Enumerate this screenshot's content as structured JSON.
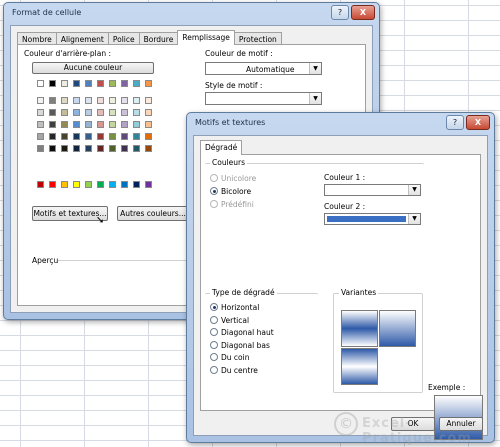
{
  "back_dialog": {
    "title": "Format de cellule",
    "tabs": [
      "Nombre",
      "Alignement",
      "Police",
      "Bordure",
      "Remplissage",
      "Protection"
    ],
    "active_tab": "Remplissage",
    "bg_color_label": "Couleur d'arrière-plan :",
    "no_color_button": "Aucune couleur",
    "pattern_color_label": "Couleur de motif :",
    "pattern_color_value": "Automatique",
    "pattern_style_label": "Style de motif :",
    "pattern_style_value": "",
    "patterns_button": "Motifs et textures...",
    "more_colors_button": "Autres couleurs...",
    "preview_label": "Aperçu",
    "help_label": "?",
    "close_label": "X"
  },
  "palette": {
    "row1": [
      "#ffffff",
      "#000000",
      "#eeece1",
      "#1f497d",
      "#4f81bd",
      "#c0504d",
      "#9bbb59",
      "#8064a2",
      "#4bacc6",
      "#f79646"
    ],
    "rows": [
      [
        "#f2f2f2",
        "#7f7f7f",
        "#ddd9c3",
        "#c6d9f0",
        "#dbe5f1",
        "#f2dcdb",
        "#ebf1dd",
        "#e5e0ec",
        "#dbeef3",
        "#fdeada"
      ],
      [
        "#d8d8d8",
        "#595959",
        "#c4bd97",
        "#8db3e2",
        "#b8cce4",
        "#e5b9b7",
        "#d7e3bc",
        "#ccc1d9",
        "#b7dde8",
        "#fbd5b5"
      ],
      [
        "#bfbfbf",
        "#3f3f3f",
        "#938953",
        "#548dd4",
        "#95b3d7",
        "#d99694",
        "#c3d69b",
        "#b2a2c7",
        "#92cddc",
        "#fac08f"
      ],
      [
        "#a5a5a5",
        "#262626",
        "#494429",
        "#17365d",
        "#366092",
        "#953734",
        "#76923c",
        "#5f497a",
        "#31859b",
        "#e36c09"
      ],
      [
        "#7f7f7f",
        "#0c0c0c",
        "#1d1b10",
        "#0f243e",
        "#244061",
        "#632423",
        "#4f6128",
        "#3f3151",
        "#205867",
        "#974806"
      ]
    ],
    "standard": [
      "#c00000",
      "#ff0000",
      "#ffc000",
      "#ffff00",
      "#92d050",
      "#00b050",
      "#00b0f0",
      "#0070c0",
      "#002060",
      "#7030a0"
    ]
  },
  "front_dialog": {
    "title": "Motifs et textures",
    "tab": "Dégradé",
    "colors_group": "Couleurs",
    "radio_unicolor": "Unicolore",
    "radio_bicolor": "Bicolore",
    "radio_preset": "Prédéfini",
    "color1_label": "Couleur 1 :",
    "color2_label": "Couleur 2 :",
    "color2_value": "#3a6fc4",
    "gradient_type_group": "Type de dégradé",
    "gradient_types": [
      "Horizontal",
      "Vertical",
      "Diagonal haut",
      "Diagonal bas",
      "Du coin",
      "Du centre"
    ],
    "variants_group": "Variantes",
    "example_label": "Exemple :",
    "ok_button": "OK",
    "cancel_button": "Annuler",
    "help_label": "?",
    "close_label": "X"
  },
  "watermark": "Excel-Pratique.com",
  "watermark_symbol": "©"
}
